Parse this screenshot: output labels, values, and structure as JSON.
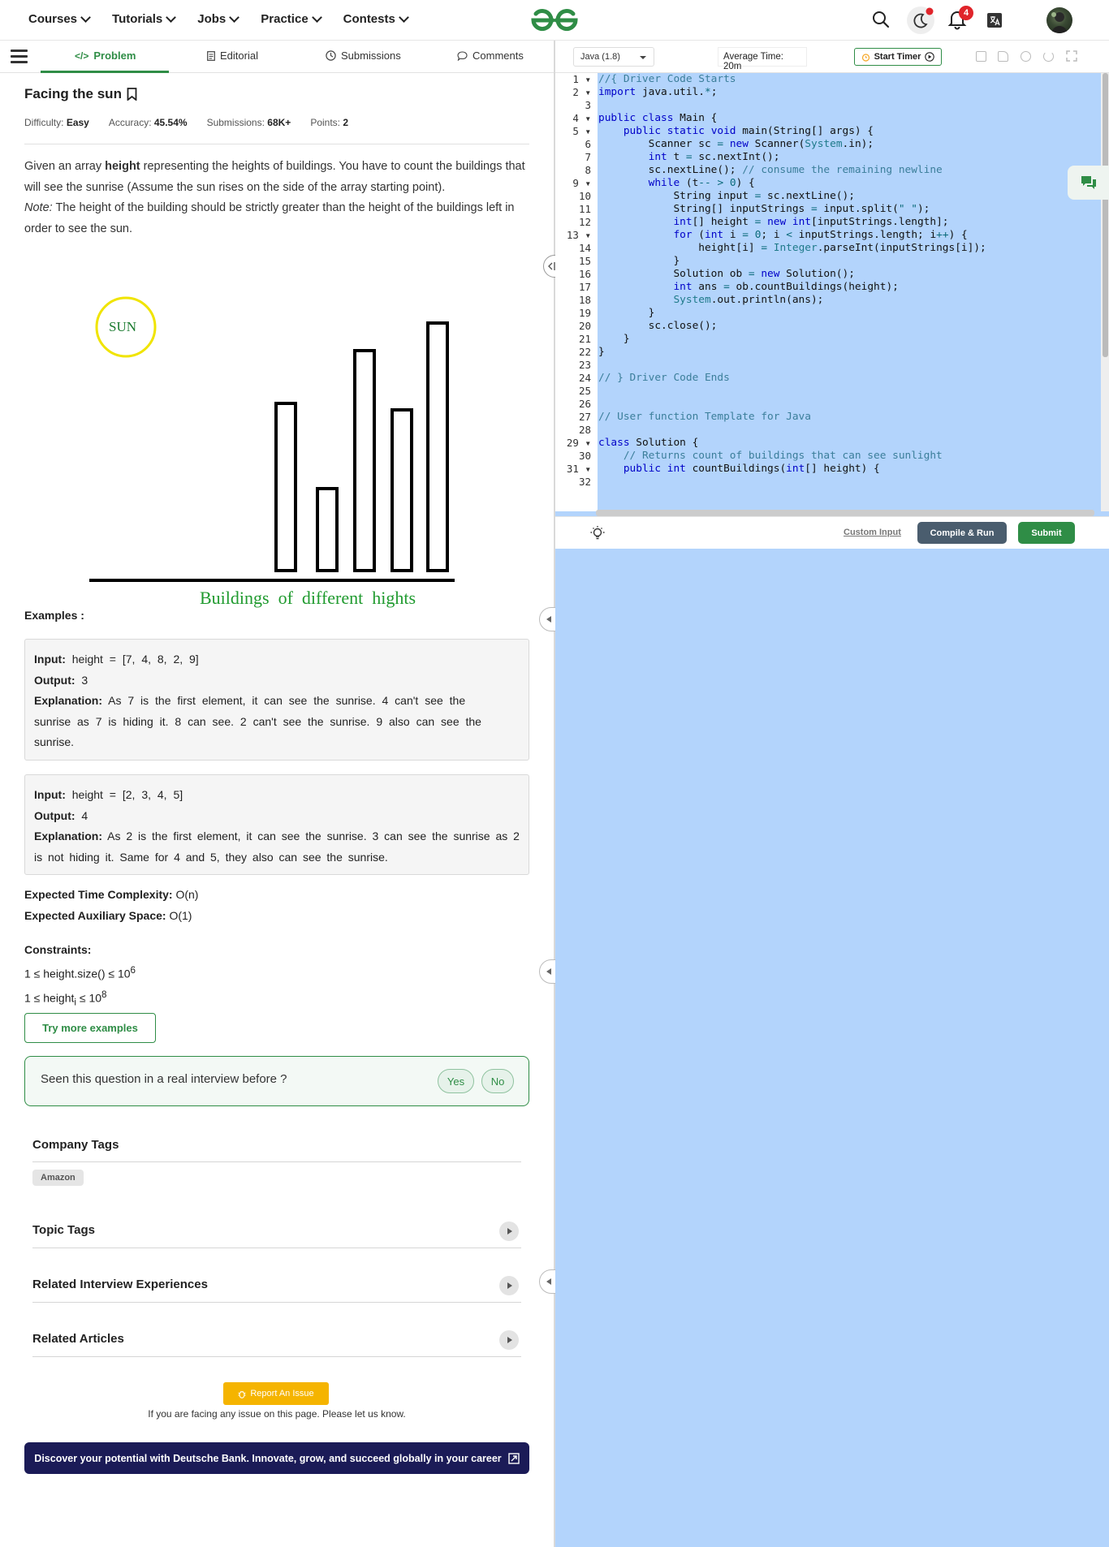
{
  "nav": {
    "menu": [
      "Courses",
      "Tutorials",
      "Jobs",
      "Practice",
      "Contests"
    ],
    "notification_count": "4"
  },
  "tabs": [
    {
      "label": "Problem"
    },
    {
      "label": "Editorial"
    },
    {
      "label": "Submissions"
    },
    {
      "label": "Comments"
    }
  ],
  "problem": {
    "title": "Facing the sun",
    "difficulty_label": "Difficulty:",
    "difficulty": "Easy",
    "accuracy_label": "Accuracy:",
    "accuracy": "45.54%",
    "submissions_label": "Submissions:",
    "submissions": "68K+",
    "points_label": "Points:",
    "points": "2",
    "desc_1a": "Given an array ",
    "desc_1b": "height",
    "desc_1c": " representing the heights of buildings. You have to count the buildings that will see the sunrise (Assume the sun rises on the side of the array starting point).",
    "note_label": "Note:",
    "note_text": " The height of the building should be strictly greater than the height of the buildings left in order to see the sun."
  },
  "figure": {
    "sun_label": "SUN",
    "caption": "Buildings  of  different  hights",
    "building_heights": [
      206,
      101,
      271,
      198,
      305
    ]
  },
  "examples": {
    "heading": "Examples :",
    "input_label": "Input:",
    "output_label": "Output:",
    "explanation_label": "Explanation:",
    "ex1_input": " height = [7, 4, 8, 2, 9]",
    "ex1_output": " 3",
    "ex1_explanation": " As 7 is the first element, it can see the sunrise. 4 can't see the sunrise as 7 is hiding it. 8 can see. 2 can't see the sunrise. 9 also can see the sunrise.",
    "ex2_input": " height = [2, 3, 4, 5]",
    "ex2_output": " 4",
    "ex2_explanation": " As 2 is the first element, it can see the sunrise.  3 can see the sunrise as 2 is not hiding it. Same for 4 and 5, they also can see the sunrise."
  },
  "complexity": {
    "time_label": "Expected Time Complexity:",
    "time": " O(n)",
    "space_label": "Expected Auxiliary Space:",
    "space": " O(1)"
  },
  "constraints": {
    "heading": "Constraints:",
    "c1": "1 ≤ height.size() ≤ 10",
    "c1_sup": "6",
    "c2a": "1 ≤ height",
    "c2_sub": "i",
    "c2b": " ≤ 10",
    "c2_sup": "8"
  },
  "try_more": "Try more examples",
  "interview": {
    "question": "Seen this question in a real interview before ?",
    "yes": "Yes",
    "no": "No"
  },
  "sections": {
    "company_tags": "Company Tags",
    "company": "Amazon",
    "topic_tags": "Topic Tags",
    "related_interview": "Related Interview Experiences",
    "related_articles": "Related Articles"
  },
  "report": {
    "button": "Report An Issue",
    "note": "If you are facing any issue on this page. Please let us know."
  },
  "banner": "Discover your potential with Deutsche Bank. Innovate, grow, and succeed globally in your career",
  "editor": {
    "language": "Java (1.8)",
    "average_time": "Average Time: 20m",
    "start_timer": "Start Timer",
    "custom_input": "Custom Input",
    "compile_run": "Compile & Run",
    "submit": "Submit",
    "line_numbers": [
      "1",
      "2",
      "3",
      "4",
      "5",
      "6",
      "7",
      "8",
      "9",
      "10",
      "11",
      "12",
      "13",
      "14",
      "15",
      "16",
      "17",
      "18",
      "19",
      "20",
      "21",
      "22",
      "23",
      "24",
      "25",
      "26",
      "27",
      "28",
      "29",
      "30",
      "31",
      "32"
    ]
  },
  "colors": {
    "brand_green": "#2f8d46",
    "selection_blue": "#b3d4fc",
    "banner_navy": "#1b1b57",
    "report_yellow": "#f5b400"
  }
}
